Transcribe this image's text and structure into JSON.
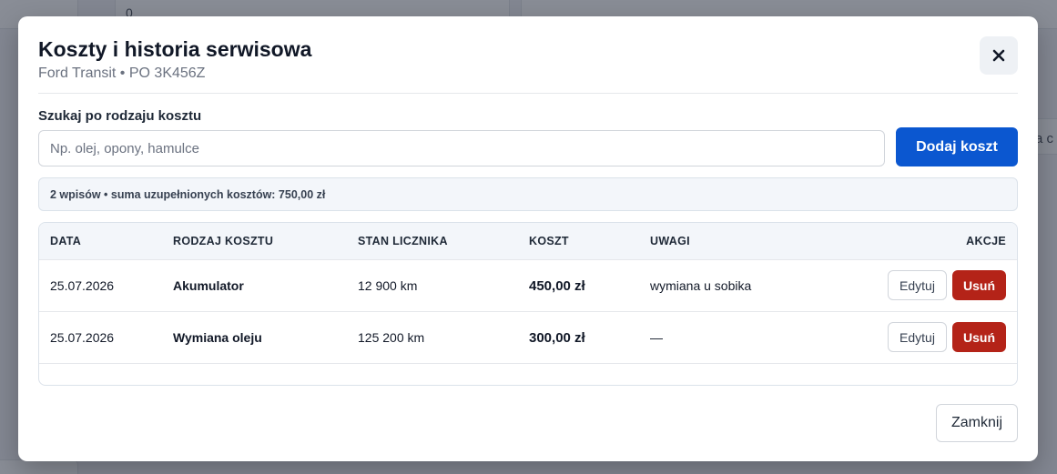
{
  "background": {
    "partial_text_right": "a c",
    "partial_text_top": "0"
  },
  "modal": {
    "title": "Koszty i historia serwisowa",
    "subtitle": "Ford Transit • PO 3K456Z",
    "close_icon": "close-icon",
    "search": {
      "label": "Szukaj po rodzaju kosztu",
      "placeholder": "Np. olej, opony, hamulce",
      "value": ""
    },
    "add_button_label": "Dodaj koszt",
    "summary": "2 wpisów • suma uzupełnionych kosztów: 750,00 zł",
    "table": {
      "headers": [
        "DATA",
        "RODZAJ KOSZTU",
        "STAN LICZNIKA",
        "KOSZT",
        "UWAGI",
        "AKCJE"
      ],
      "rows": [
        {
          "date": "25.07.2026",
          "type": "Akumulator",
          "odometer": "12 900 km",
          "cost": "450,00 zł",
          "notes": "wymiana u sobika",
          "edit": "Edytuj",
          "delete": "Usuń"
        },
        {
          "date": "25.07.2026",
          "type": "Wymiana oleju",
          "odometer": "125 200 km",
          "cost": "300,00 zł",
          "notes": "—",
          "edit": "Edytuj",
          "delete": "Usuń"
        }
      ]
    },
    "footer_close_label": "Zamknij"
  },
  "colors": {
    "primary": "#0b57d0",
    "danger": "#b42318",
    "overlay": "#3c4250"
  }
}
